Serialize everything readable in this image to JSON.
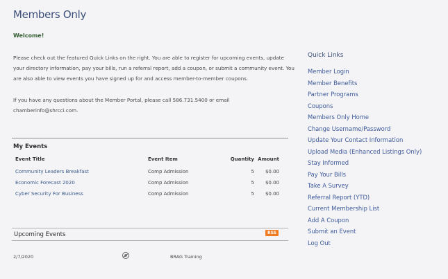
{
  "page": {
    "title": "Members Only",
    "welcome": "Welcome!",
    "intro_paragraph_1": "Please check out the featured Quick Links on the right. You are able to register for upcoming events, update your directory information, pay your bills, run a referral report, add a coupon, or submit a community event. You are also able to view events you have signed up for and access member-to-member coupons.",
    "intro_paragraph_2": "If you have any questions about the Member Portal, please call 586.731.5400 or email chamberinfo@shrcci.com."
  },
  "my_events": {
    "title": "My Events",
    "columns": [
      "Event Title",
      "Event Item",
      "Quantity",
      "Amount"
    ],
    "rows": [
      {
        "title": "Community Leaders Breakfast",
        "item": "Comp Admission",
        "quantity": "5",
        "amount": "$0.00"
      },
      {
        "title": "Economic Forecast 2020",
        "item": "Comp Admission",
        "quantity": "5",
        "amount": "$0.00"
      },
      {
        "title": "Cyber Security For Business",
        "item": "Comp Admission",
        "quantity": "5",
        "amount": "$0.00"
      }
    ]
  },
  "upcoming": {
    "title": "Upcoming Events",
    "rss_label": "RSS",
    "rows": [
      {
        "date": "2/7/2020",
        "icon": "event-logo-icon",
        "name": "BRAG Training"
      }
    ]
  },
  "quick_links": {
    "title": "Quick Links",
    "items": [
      "Member Login",
      "Member Benefits",
      "Partner Programs",
      "Coupons",
      "Members Only Home",
      "Change Username/Password",
      "Update Your Contact Information",
      "Upload Media (Enhanced Listings Only)",
      "Stay Informed",
      "Pay Your Bills",
      "Take A Survey",
      "Referral Report (YTD)",
      "Current Membership List",
      "Add A Coupon",
      "Submit an Event",
      "Log Out"
    ]
  },
  "colors": {
    "title": "#3d4f7a",
    "link": "#3d5a9a",
    "welcome": "#2e5a2e",
    "rss": "#f07a1f",
    "background": "#f4f4f6"
  }
}
